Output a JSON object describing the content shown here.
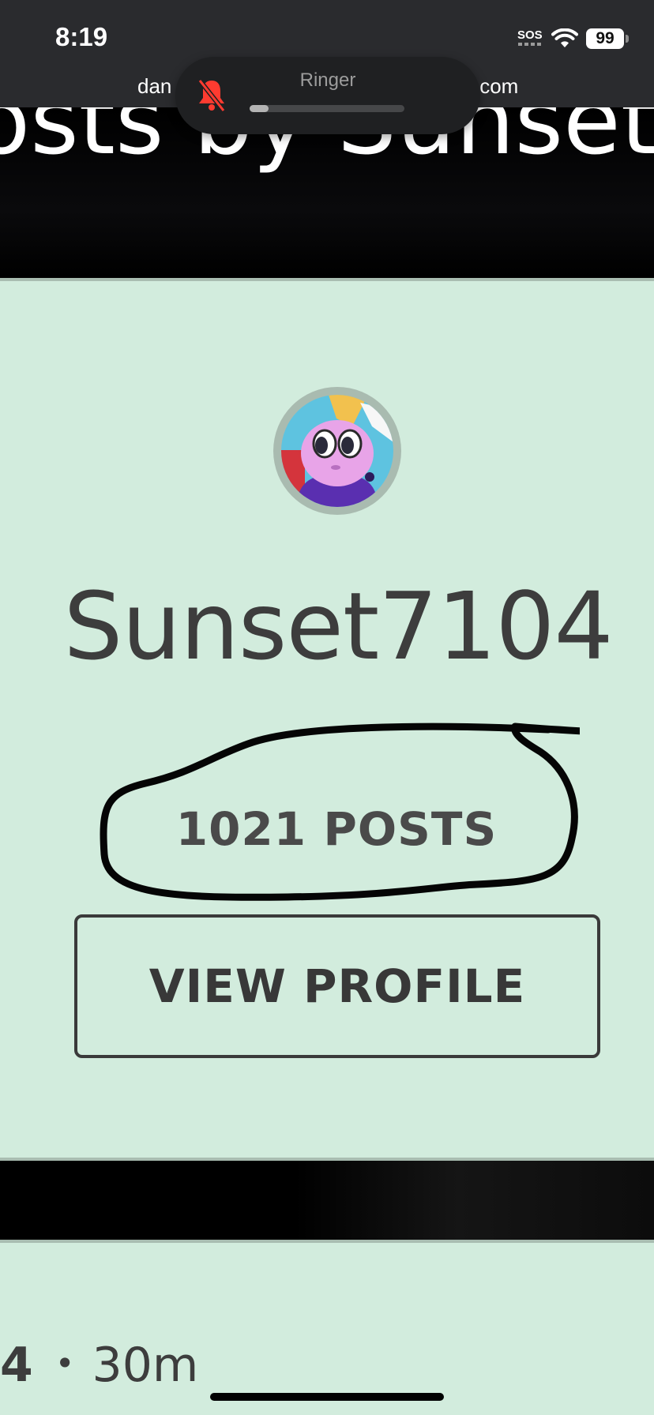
{
  "status_bar": {
    "time": "8:19",
    "sos": "SOS",
    "battery": "99",
    "url_left": "dan",
    "url_right": ".com"
  },
  "ringer": {
    "label": "Ringer",
    "level": 0.12,
    "muted": true
  },
  "hero": {
    "title": "osts by Sunset"
  },
  "profile": {
    "username": "Sunset7104",
    "posts_count": "1021 POSTS",
    "view_profile_label": "VIEW PROFILE"
  },
  "next_post": {
    "number": "4",
    "separator": "•",
    "age": "30m"
  },
  "colors": {
    "card_background": "#d2ecdd",
    "ringer_muted_icon": "#ff3b30",
    "text_dark": "#3d3d3d"
  },
  "icons": [
    "wifi-icon",
    "battery-icon",
    "bell-slash-icon"
  ]
}
